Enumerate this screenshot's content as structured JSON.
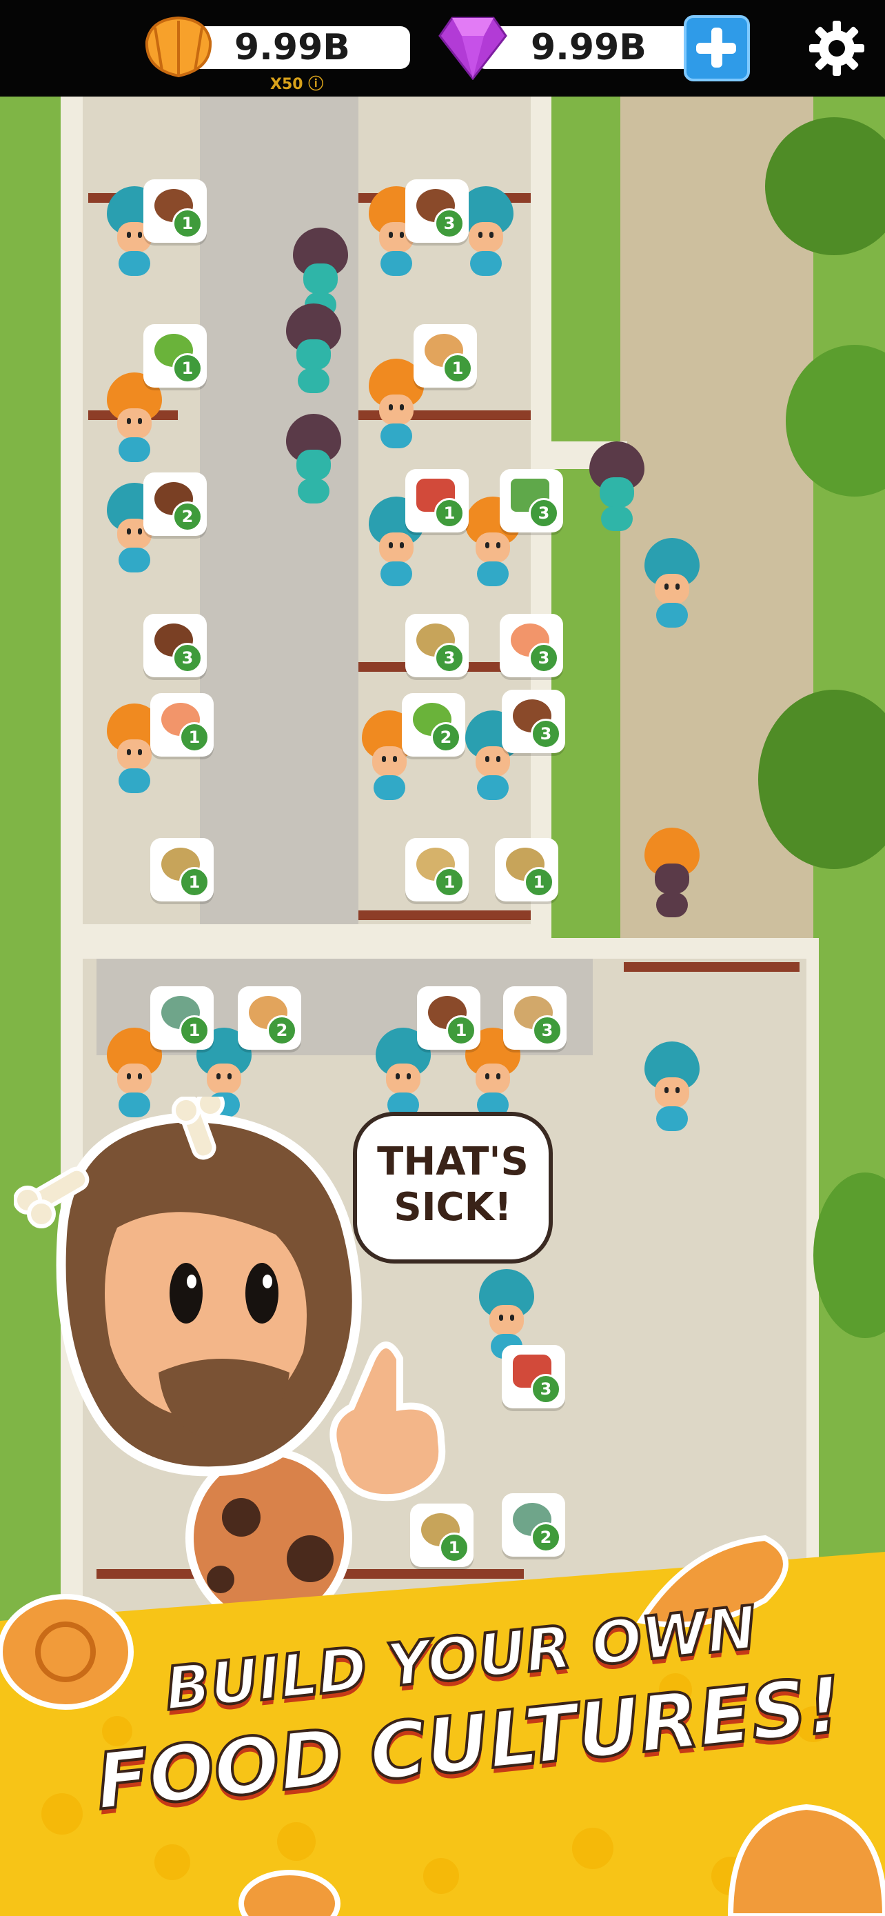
{
  "hud": {
    "shells_value": "9.99B",
    "shells_icon": "shell-currency-icon",
    "multiplier": "X50",
    "gems_value": "9.99B",
    "gems_icon": "purple-gem-icon",
    "add_icon": "plus-icon",
    "settings_icon": "gear-icon"
  },
  "speech_bubble": {
    "line1": "THAT'S",
    "line2": "SICK!"
  },
  "banner": {
    "line1": "BUILD YOUR OWN",
    "line2": "FOOD CULTURES!"
  },
  "food_orders": [
    {
      "food": "soup-bowl-icon",
      "count": "1"
    },
    {
      "food": "soup-bowl-icon",
      "count": "3"
    },
    {
      "food": "salad-icon",
      "count": "1"
    },
    {
      "food": "mixed-plate-icon",
      "count": "1"
    },
    {
      "food": "stew-bowl-icon",
      "count": "2"
    },
    {
      "food": "meat-skewer-icon",
      "count": "1"
    },
    {
      "food": "steak-platter-icon",
      "count": "3"
    },
    {
      "food": "stew-bowl-icon",
      "count": "3"
    },
    {
      "food": "coconut-icon",
      "count": "3"
    },
    {
      "food": "salmon-icon",
      "count": "3"
    },
    {
      "food": "salmon-icon",
      "count": "1"
    },
    {
      "food": "salad-icon",
      "count": "2"
    },
    {
      "food": "soup-bowl-icon",
      "count": "3"
    },
    {
      "food": "coconut-icon",
      "count": "1"
    },
    {
      "food": "coconut-icon",
      "count": "1"
    },
    {
      "food": "coconut-icon",
      "count": "1"
    },
    {
      "food": "noodle-bowl-icon",
      "count": "1"
    },
    {
      "food": "mixed-plate-icon",
      "count": "2"
    },
    {
      "food": "soup-bowl-icon",
      "count": "1"
    },
    {
      "food": "drumstick-icon",
      "count": "3"
    },
    {
      "food": "meat-skewer-icon",
      "count": "3"
    },
    {
      "food": "noodle-bowl-icon",
      "count": "2"
    },
    {
      "food": "coconut-icon",
      "count": "1"
    }
  ],
  "colors": {
    "hud_bg": "#050505",
    "grass": "#7fb546",
    "count_badge": "#3f9b3b",
    "plus_button": "#2f9be8",
    "banner_yellow": "#f7c417",
    "text_outline": "#3a2318"
  }
}
